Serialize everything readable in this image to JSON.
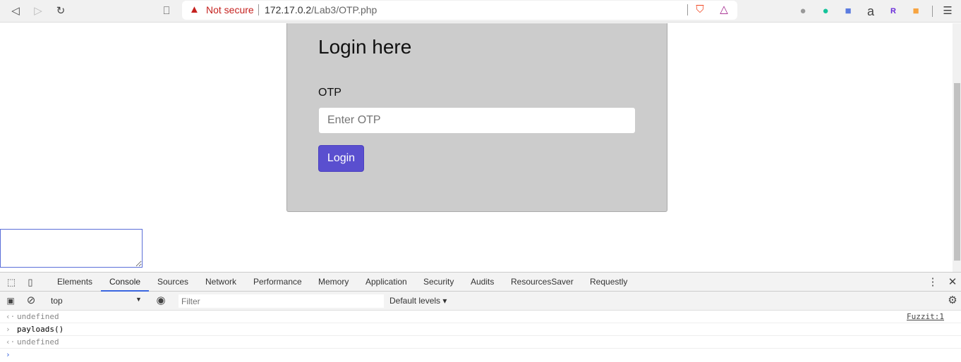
{
  "browser": {
    "security_label": "Not secure",
    "url_host": "172.17.0.2",
    "url_path": "/Lab3/OTP.php"
  },
  "page": {
    "title": "Login here",
    "otp_label": "OTP",
    "otp_placeholder": "Enter OTP",
    "login_button": "Login"
  },
  "devtools": {
    "tabs": [
      "Elements",
      "Console",
      "Sources",
      "Network",
      "Performance",
      "Memory",
      "Application",
      "Security",
      "Audits",
      "ResourcesSaver",
      "Requestly"
    ],
    "active_tab": "Console",
    "context": "top",
    "filter_placeholder": "Filter",
    "levels": "Default levels",
    "console": [
      {
        "type": "result",
        "text": "undefined",
        "source": "Fuzzit:1"
      },
      {
        "type": "input",
        "text": "payloads()"
      },
      {
        "type": "result",
        "text": "undefined"
      }
    ]
  }
}
